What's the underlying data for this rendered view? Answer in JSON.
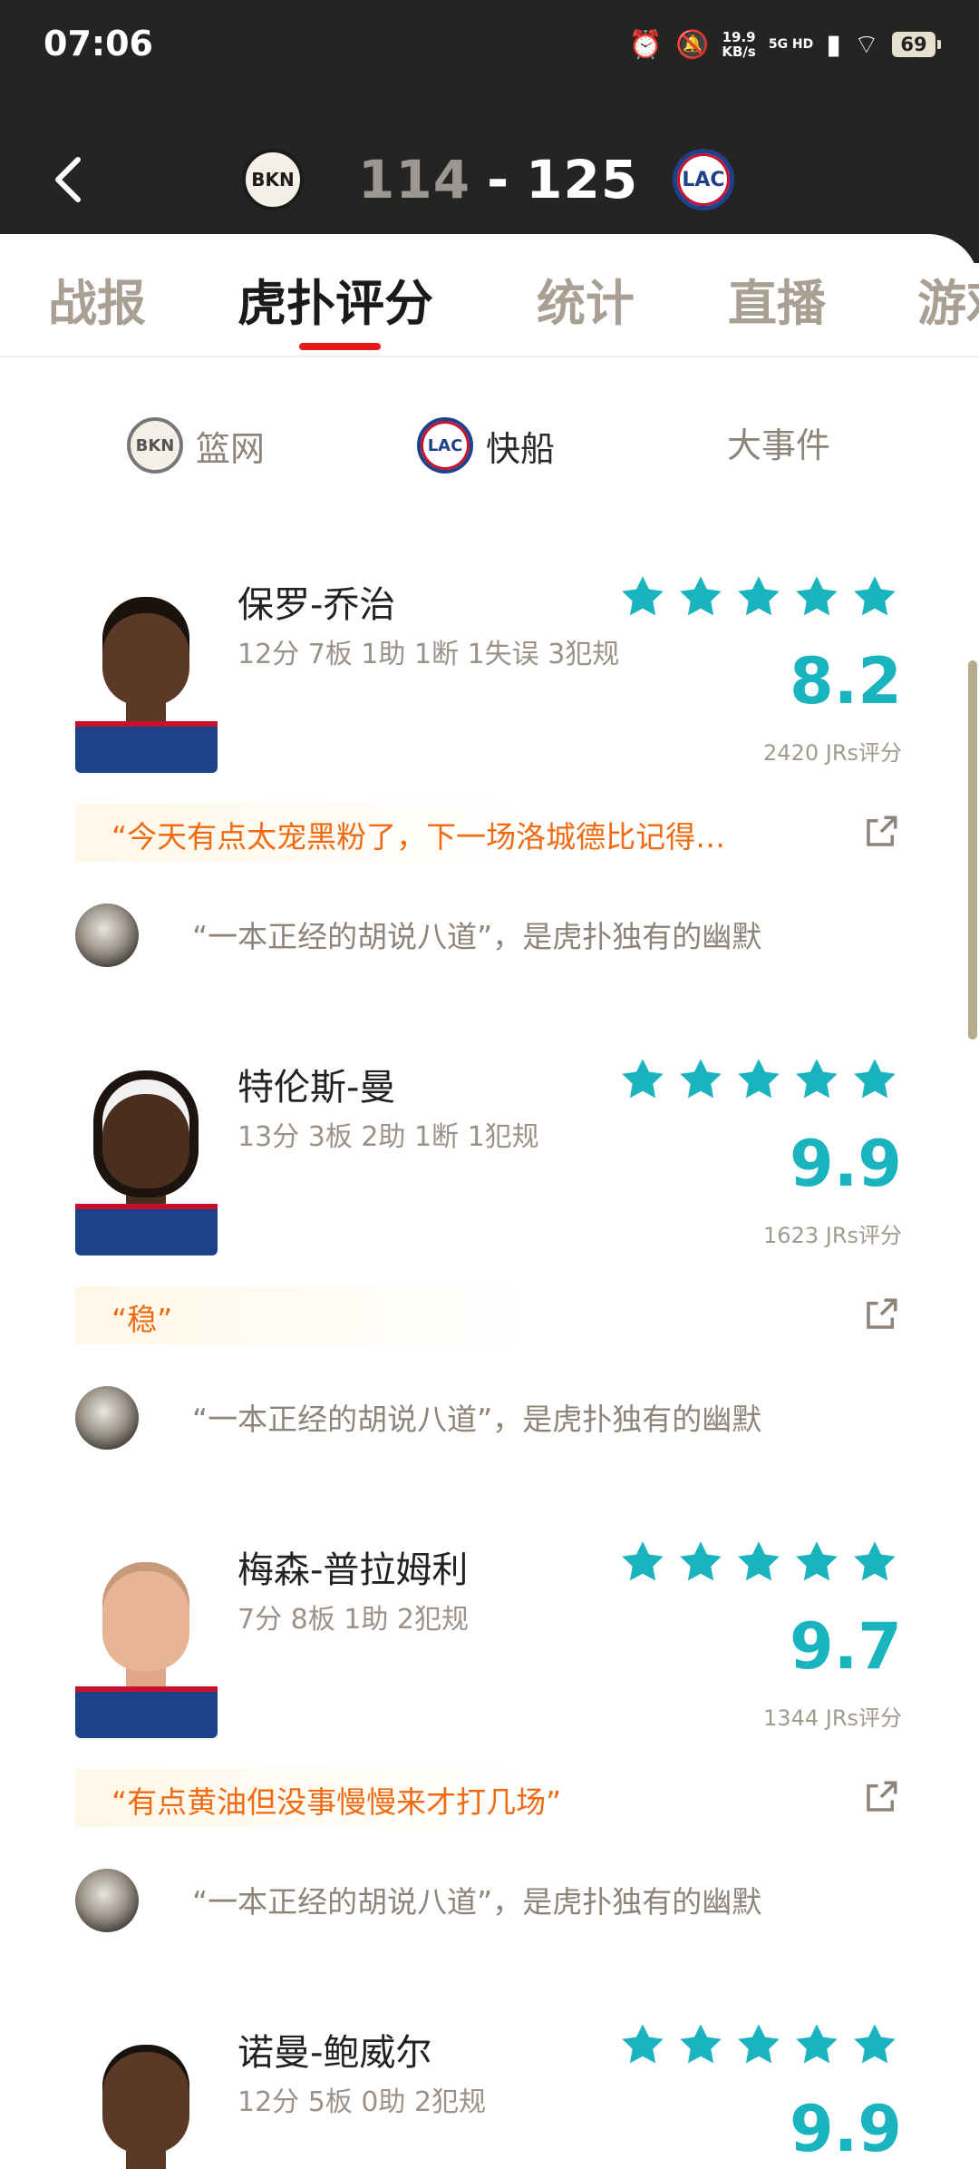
{
  "status_bar": {
    "time": "07:06",
    "net_speed_value": "19.9",
    "net_speed_unit": "KB/s",
    "network_label": "5G HD",
    "battery": "69"
  },
  "game": {
    "home_team_logo": "BKN",
    "away_team_logo": "LAC",
    "home_score": "114",
    "separator": "-",
    "away_score": "125"
  },
  "tabs": [
    "战报",
    "虎扑评分",
    "统计",
    "直播",
    "游戏"
  ],
  "filters": [
    {
      "logo": "BKN",
      "label": "篮网"
    },
    {
      "logo": "LAC",
      "label": "快船"
    },
    {
      "label": "大事件"
    }
  ],
  "players": [
    {
      "name": "保罗-乔治",
      "stats": "12分 7板 1助 1断 1失误 3犯规",
      "rating": "8.2",
      "votes": "2420 JRs评分",
      "stars": 5,
      "top_comment": "“今天有点太宠黑粉了，下一场洛城德比记得…",
      "comment": "“一本正经的胡说八道”，是虎扑独有的幽默"
    },
    {
      "name": "特伦斯-曼",
      "stats": "13分 3板 2助 1断 1犯规",
      "rating": "9.9",
      "votes": "1623 JRs评分",
      "stars": 5,
      "top_comment": "“稳”",
      "comment": "“一本正经的胡说八道”，是虎扑独有的幽默"
    },
    {
      "name": "梅森-普拉姆利",
      "stats": "7分 8板 1助 2犯规",
      "rating": "9.7",
      "votes": "1344 JRs评分",
      "stars": 5,
      "top_comment": "“有点黄油但没事慢慢来才打几场”",
      "comment": "“一本正经的胡说八道”，是虎扑独有的幽默"
    },
    {
      "name": "诺曼-鲍威尔",
      "stats": "12分 5板 0助 2犯规",
      "rating": "9.9",
      "stars": 5
    }
  ],
  "colors": {
    "header_bg": "#262422",
    "accent_red": "#e21a1a",
    "rating_teal": "#1ab4bf",
    "quote_orange": "#f06a12"
  }
}
